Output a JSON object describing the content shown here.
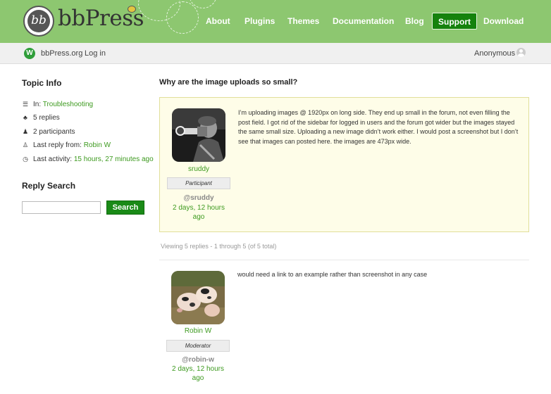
{
  "header": {
    "logo_mark": "bb",
    "logo_text": "bbPress",
    "nav": [
      {
        "label": "About"
      },
      {
        "label": "Plugins"
      },
      {
        "label": "Themes"
      },
      {
        "label": "Documentation"
      },
      {
        "label": "Blog"
      },
      {
        "label": "Support",
        "active": true
      },
      {
        "label": "Download"
      }
    ],
    "brand_color": "#8dc770",
    "active_color": "#15820d"
  },
  "subbar": {
    "wp_icon": "wordpress-icon",
    "wp_glyph": "W",
    "site_link": "bbPress.org",
    "login_link": "Log in",
    "user_label": "Anonymous",
    "user_icon": "user-icon"
  },
  "sidebar": {
    "topic_info_title": "Topic Info",
    "forum_prefix": "In:",
    "forum_name": "Troubleshooting",
    "replies": "5 replies",
    "participants": "2 participants",
    "last_reply_prefix": "Last reply from:",
    "last_reply_author": "Robin W",
    "last_activity_prefix": "Last activity:",
    "last_activity_value": "15 hours, 27 minutes ago",
    "reply_search_title": "Reply Search",
    "search_placeholder": "",
    "search_button": "Search"
  },
  "topic": {
    "title": "Why are the image uploads so small?",
    "lead": {
      "author": "sruddy",
      "role": "Participant",
      "handle": "@sruddy",
      "time_line1": "2 days, 12 hours",
      "time_line2": "ago",
      "body": "I’m uploading images @ 1920px on long side. They end up small in the forum, not even filling the post field. I got rid of the sidebar for logged in users and the forum got wider but the images stayed the same small size. Uploading a new image didn’t work either. I would post a screenshot but I don’t see that images can posted here. the images are 473px wide."
    },
    "pagination": "Viewing 5 replies - 1 through 5 (of 5 total)",
    "replies": [
      {
        "author": "Robin W",
        "role": "Moderator",
        "handle": "@robin-w",
        "time_line1": "2 days, 12 hours",
        "time_line2": "ago",
        "body": "would need a link to an example rather than screenshot in any case"
      }
    ]
  }
}
